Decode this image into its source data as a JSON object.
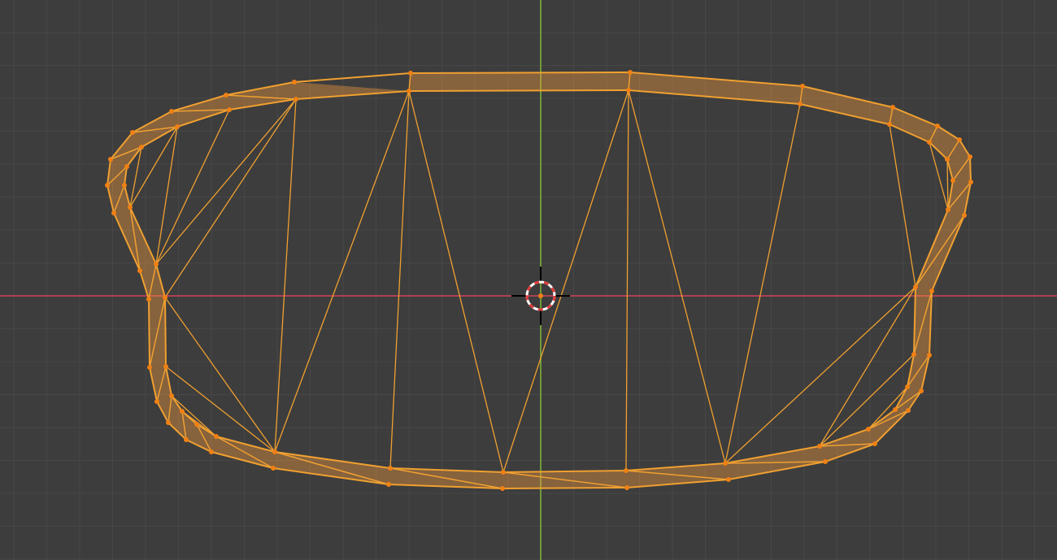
{
  "viewport": {
    "view": "3d-viewport-top-orthographic",
    "mode": "edit-mode",
    "select_mode": "vertex"
  },
  "colors": {
    "background": "#3d3d3d",
    "grid_minor": "#474747",
    "grid_major": "#525252",
    "x_axis": "#d1435a",
    "y_axis": "#6f9a3a",
    "selected_edge": "#f0a030",
    "selected_face": "#ffa040",
    "vertex": "#f08014",
    "cursor_ring_red": "#e03a3a",
    "cursor_ring_white": "#ffffff"
  },
  "icons": {
    "cursor": "3d-cursor-icon"
  },
  "mesh": {
    "name": "",
    "vertex_count": 80,
    "all_selected": true
  }
}
